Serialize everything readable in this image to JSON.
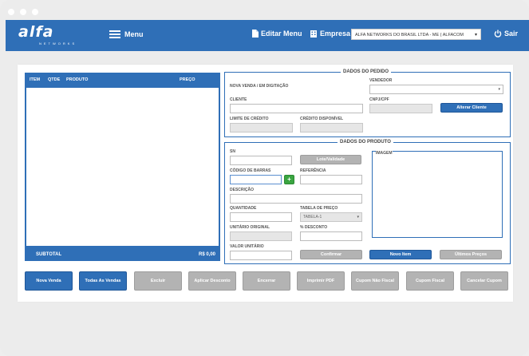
{
  "header": {
    "logo": "alfa",
    "logo_sub": "NETWORKS",
    "menu_label": "Menu",
    "edit_menu_label": "Editar Menu",
    "company_label": "Empresa",
    "company_value": "ALFA NETWORKS DO BRASIL LTDA - ME ( ALFACOM",
    "exit_label": "Sair"
  },
  "cart": {
    "columns": [
      "ITEM",
      "QTDE",
      "PRODUTO",
      "PREÇO"
    ],
    "subtotal_label": "SUBTOTAL",
    "subtotal_value": "R$ 0,00"
  },
  "order": {
    "title": "DADOS DO PEDIDO",
    "status": "NOVA VENDA / EM DIGITAÇÃO",
    "seller_label": "VENDEDOR",
    "client_label": "CLIENTE",
    "cnpj_label": "CNPJ/CPF",
    "change_client_button": "Alterar Cliente",
    "credit_limit_label": "LIMITE DE CRÉDITO",
    "credit_available_label": "CRÉDITO DISPONÍVEL"
  },
  "product": {
    "title": "DADOS DO PRODUTO",
    "sn_label": "SN",
    "batch_button": "Lote/Validade",
    "image_label": "IMAGEM",
    "barcode_label": "CÓDIGO DE BARRAS",
    "add_symbol": "+",
    "reference_label": "REFERÊNCIA",
    "description_label": "DESCRIÇÃO",
    "quantity_label": "QUANTIDADE",
    "price_table_label": "TABELA DE PREÇO",
    "price_table_value": "TABELA-1",
    "original_unit_label": "UNITÁRIO ORIGINAL",
    "discount_label": "% DESCONTO",
    "unit_value_label": "VALOR UNITÁRIO",
    "confirm_button": "Confirmar",
    "new_item_button": "Novo Item",
    "last_prices_button": "Últimos Preços"
  },
  "actions": {
    "new_sale": "Nova Venda",
    "all_sales": "Todas As Vendas",
    "delete": "Excluir",
    "apply_discount": "Aplicar Desconto",
    "close": "Encerrar",
    "print_pdf": "Imprimir PDF",
    "non_fiscal_coupon": "Cupom Não Fiscal",
    "fiscal_coupon": "Cupom Fiscal",
    "cancel_coupon": "Cancelar Cupom"
  }
}
